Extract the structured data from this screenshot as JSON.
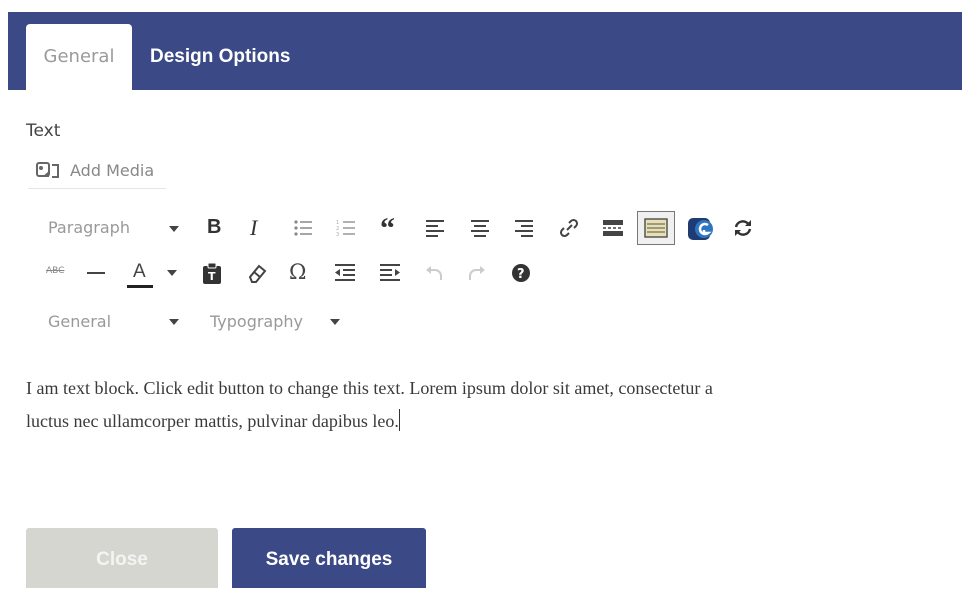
{
  "tabs": [
    {
      "label": "General",
      "active": true
    },
    {
      "label": "Design Options",
      "active": false
    }
  ],
  "field_label": "Text",
  "add_media_label": "Add Media",
  "toolbar": {
    "format_select": "Paragraph",
    "bold": "B",
    "italic": "I",
    "blockquote": "“",
    "omega": "Ω",
    "abc": "ABC",
    "text_color": "A",
    "general_select": "General",
    "typography_select": "Typography",
    "icons": [
      "bold-icon",
      "italic-icon",
      "bullet-list-icon",
      "numbered-list-icon",
      "blockquote-icon",
      "align-left-icon",
      "align-center-icon",
      "align-right-icon",
      "link-icon",
      "read-more-icon",
      "toolbar-toggle-icon",
      "grammarly-icon",
      "refresh-icon",
      "strikethrough-icon",
      "horizontal-line-icon",
      "text-color-icon",
      "paste-text-icon",
      "clear-formatting-icon",
      "special-character-icon",
      "outdent-icon",
      "indent-icon",
      "undo-icon",
      "redo-icon",
      "help-icon"
    ]
  },
  "content": {
    "line1": "I am text block. Click edit button to change this text. Lorem ipsum dolor sit amet, consectetur a",
    "line2": "luctus nec ullamcorper mattis, pulvinar dapibus leo."
  },
  "buttons": {
    "close": "Close",
    "save": "Save changes"
  },
  "colors": {
    "header": "#3b4a86",
    "save_button": "#3b4a86",
    "close_button": "#d6d6d1"
  }
}
